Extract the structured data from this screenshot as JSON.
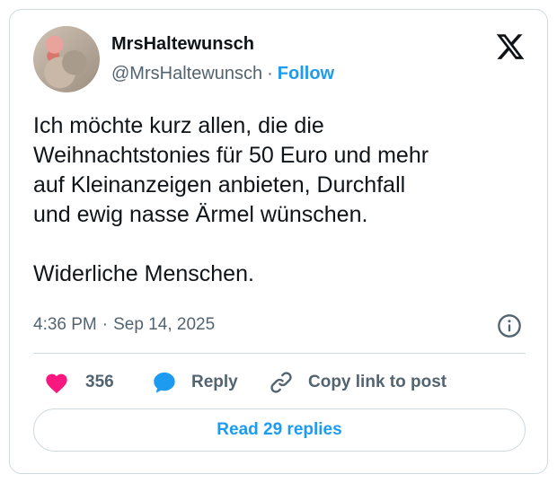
{
  "author": {
    "display_name": "MrsHaltewunsch",
    "handle": "@MrsHaltewunsch",
    "separator": "·",
    "follow_label": "Follow"
  },
  "tweet": {
    "lines": [
      "Ich möchte kurz allen, die die",
      "Weihnachtstonies für 50 Euro und mehr",
      "auf Kleinanzeigen anbieten, Durchfall",
      "und ewig nasse Ärmel wünschen."
    ],
    "closing": "Widerliche Menschen."
  },
  "meta": {
    "time": "4:36 PM",
    "separator": "·",
    "date": "Sep 14, 2025"
  },
  "actions": {
    "like_count": "356",
    "reply_label": "Reply",
    "copy_label": "Copy link to post"
  },
  "read_replies_label": "Read 29 replies",
  "colors": {
    "accent": "#1d9bf0",
    "like": "#f91880",
    "text": "#0f1419",
    "secondary": "#536471",
    "border": "#cfd9de"
  },
  "icons": [
    "x-logo-icon",
    "heart-icon",
    "reply-bubble-icon",
    "link-icon",
    "info-icon"
  ]
}
